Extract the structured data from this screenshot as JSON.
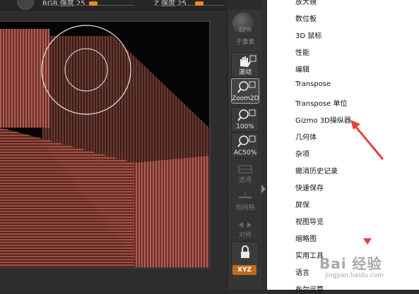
{
  "top_sliders": [
    {
      "label": "RGB 强度 25"
    },
    {
      "label": "Z 强度 25"
    }
  ],
  "bpr": {
    "label": "BPR",
    "sub_label": "子像素"
  },
  "toolbar": [
    {
      "id": "scroll",
      "label": "滚动",
      "icon": "hand-icon",
      "active": false,
      "dim": false
    },
    {
      "id": "zoom2d",
      "label": "Zoom2D",
      "icon": "zoom2d-icon",
      "active": true,
      "dim": false
    },
    {
      "id": "100",
      "label": "100%",
      "icon": "zoom-100-icon",
      "active": false,
      "dim": false
    },
    {
      "id": "ac50",
      "label": "AC50%",
      "icon": "ac50-icon",
      "active": false,
      "dim": false
    },
    {
      "id": "persp",
      "label": "透视",
      "icon": "perspective-icon",
      "active": false,
      "dim": true
    },
    {
      "id": "floor",
      "label": "地网格",
      "icon": "floor-grid-icon",
      "active": false,
      "dim": true
    },
    {
      "id": "sym",
      "label": "对称",
      "icon": "symmetry-icon",
      "active": false,
      "dim": true
    },
    {
      "id": "lock",
      "label": "",
      "icon": "local-lock-icon",
      "active": false,
      "dim": false
    }
  ],
  "xyz_label": "XYZ",
  "menu_items": [
    "放大镜",
    "数位板",
    "3D 鼠标",
    "性能",
    "编辑",
    "Transpose",
    "Transpose 单位",
    "Gizmo 3D操纵器",
    "几何体",
    "杂项",
    "撤消历史记录",
    "快速保存",
    "屏保",
    "视图导览",
    "缩略图",
    "实用工具",
    "语言",
    "布尔运算"
  ],
  "watermark": {
    "logo": "Bai 经验",
    "url": "jingyan.baidu.com"
  },
  "colors": {
    "annotation_arrow": "#e8413a",
    "accent_orange": "#f08a1c",
    "mesh_red": "#c27a72"
  }
}
